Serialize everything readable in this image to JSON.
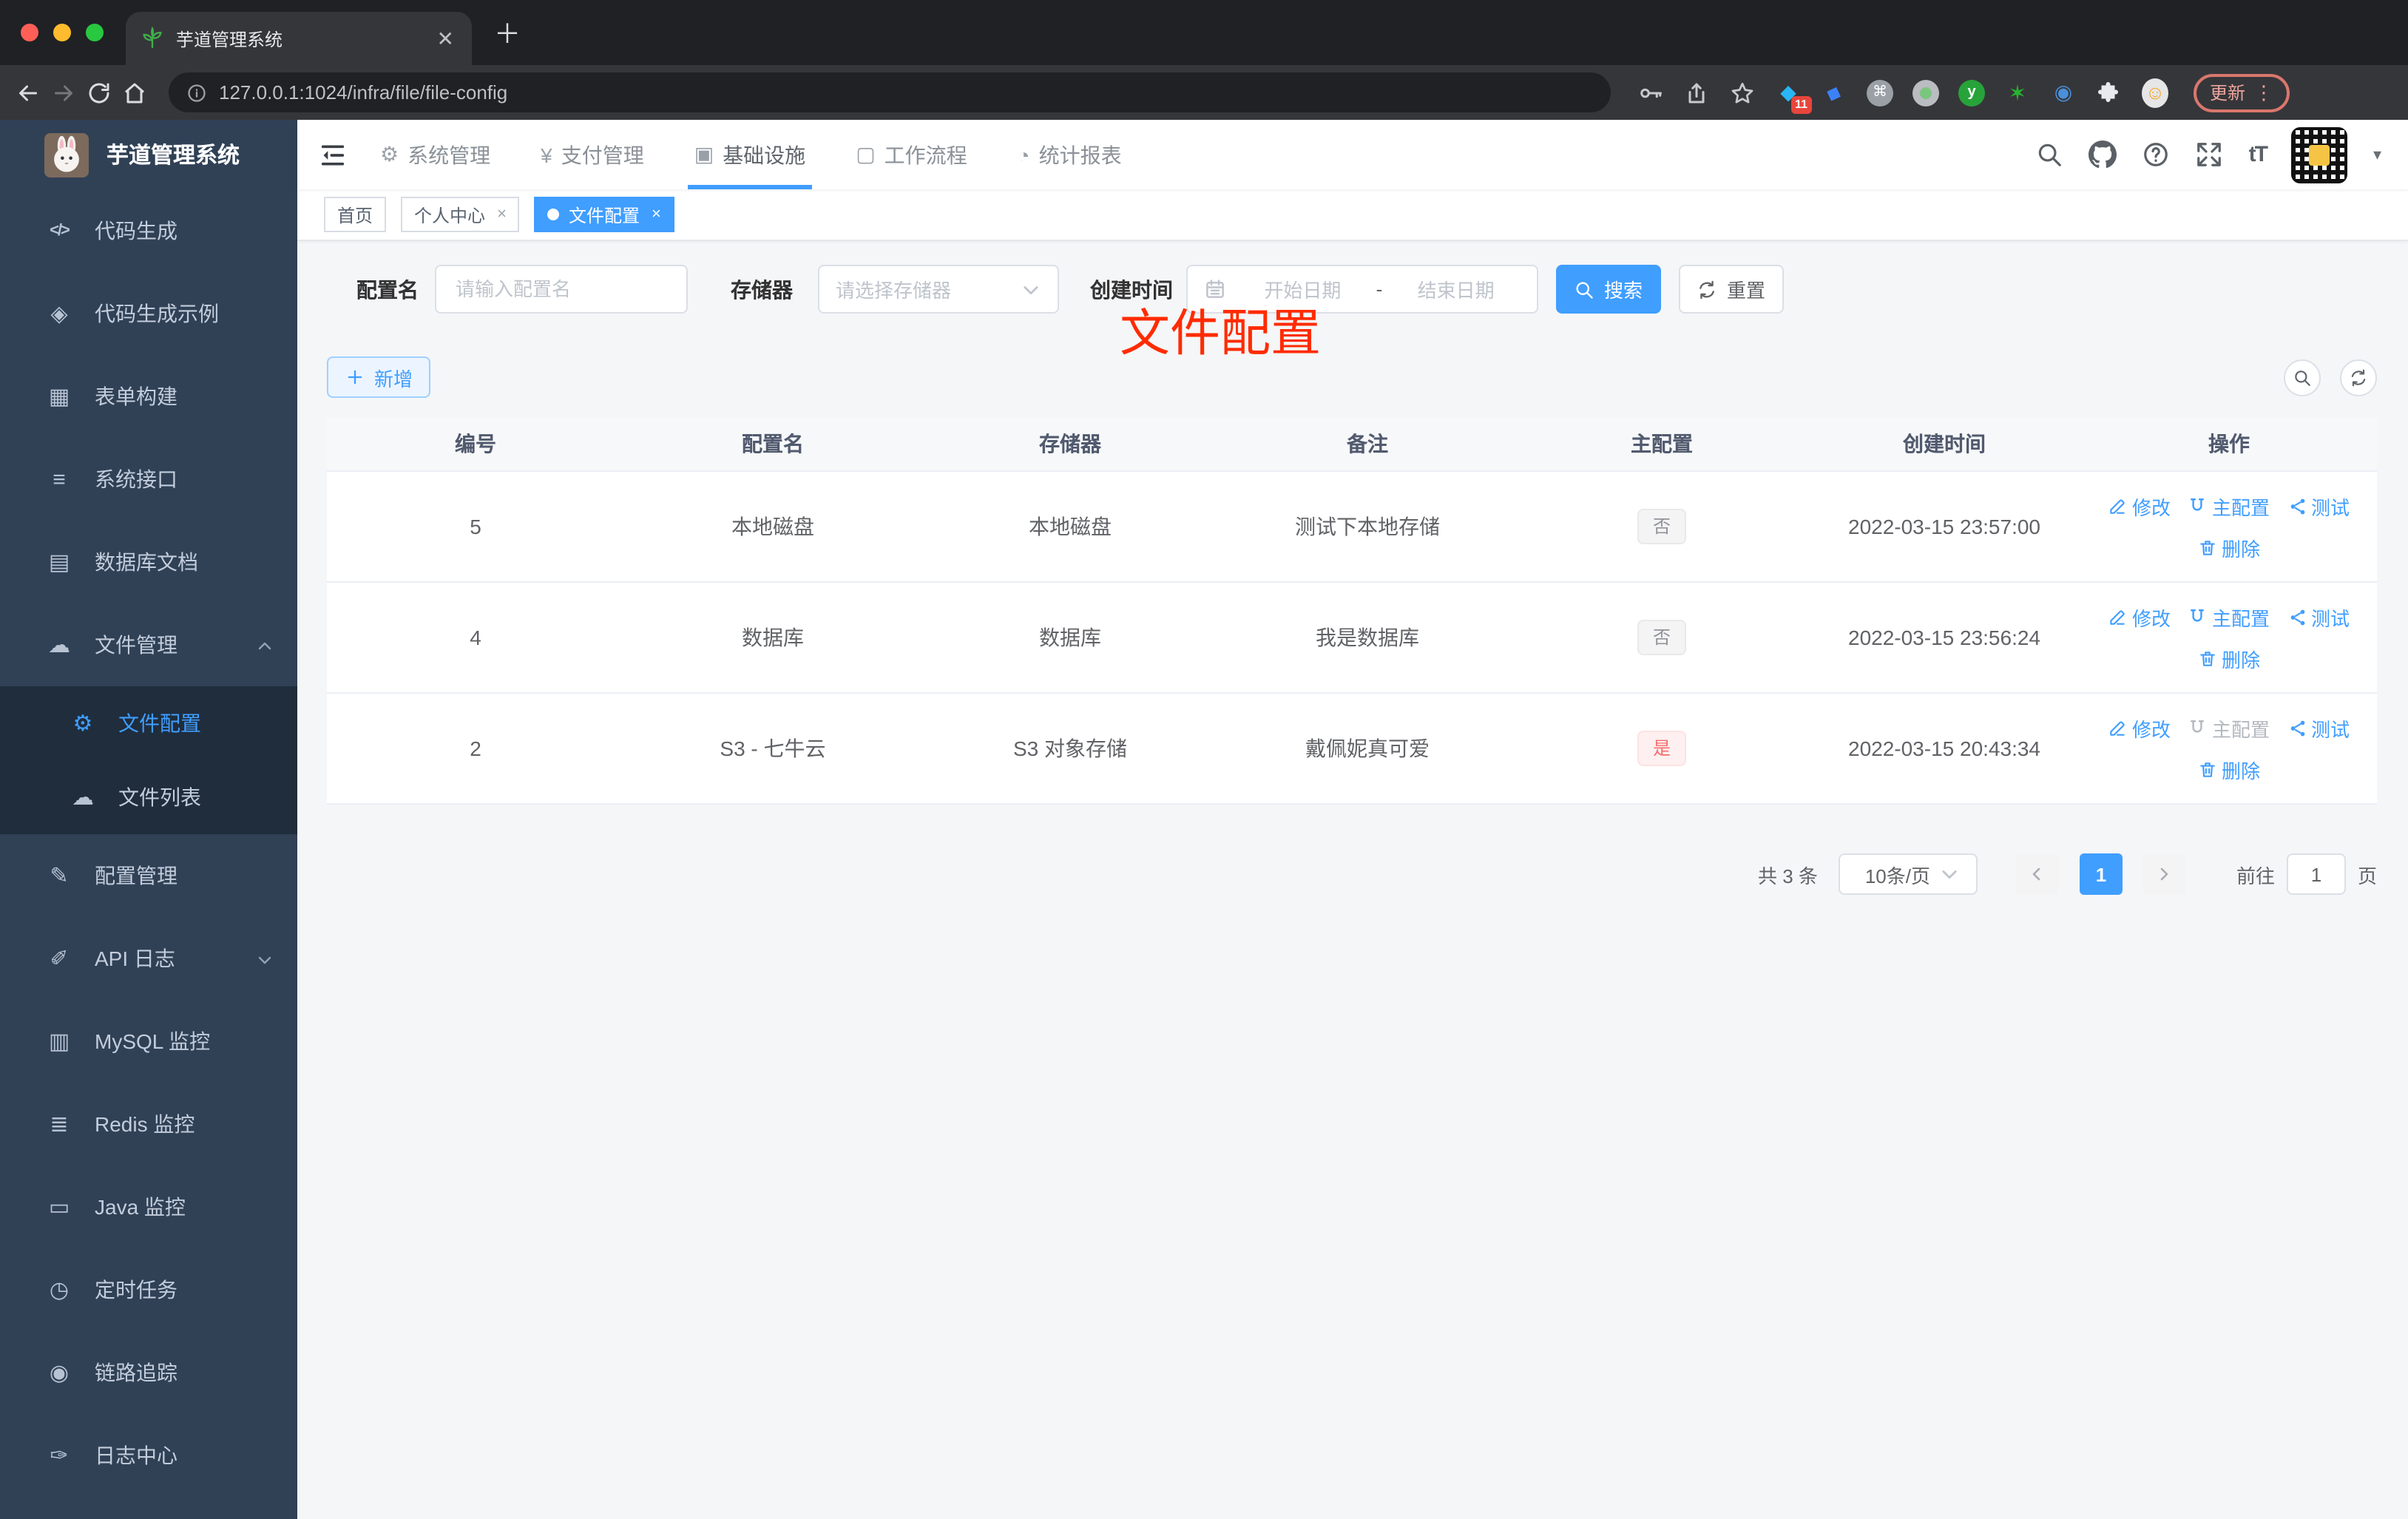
{
  "browser": {
    "tab_title": "芋道管理系统",
    "url": "127.0.0.1:1024/infra/file/file-config",
    "update_label": "更新",
    "ext_badge": "11",
    "cmd_glyph": "⌘",
    "y_glyph": "y"
  },
  "header": {
    "menus": [
      {
        "label": "系统管理",
        "icon": "⚙"
      },
      {
        "label": "支付管理",
        "icon": "¥"
      },
      {
        "label": "基础设施",
        "icon": "▣"
      },
      {
        "label": "工作流程",
        "icon": "▢"
      },
      {
        "label": "统计报表",
        "icon": "◔"
      }
    ],
    "font_size_glyph": "tT",
    "caret_glyph": "▾"
  },
  "sidebar": {
    "title": "芋道管理系统",
    "items": [
      {
        "label": "代码生成",
        "icon": "</>"
      },
      {
        "label": "代码生成示例",
        "icon": "◈"
      },
      {
        "label": "表单构建",
        "icon": "▦"
      },
      {
        "label": "系统接口",
        "icon": "≡"
      },
      {
        "label": "数据库文档",
        "icon": "▤"
      },
      {
        "label": "文件管理",
        "icon": "☁"
      },
      {
        "label": "文件配置",
        "icon": "⚙"
      },
      {
        "label": "文件列表",
        "icon": "☁"
      },
      {
        "label": "配置管理",
        "icon": "✎"
      },
      {
        "label": "API 日志",
        "icon": "✐"
      },
      {
        "label": "MySQL 监控",
        "icon": "▥"
      },
      {
        "label": "Redis 监控",
        "icon": "≣"
      },
      {
        "label": "Java 监控",
        "icon": "▭"
      },
      {
        "label": "定时任务",
        "icon": "◷"
      },
      {
        "label": "链路追踪",
        "icon": "◉"
      },
      {
        "label": "日志中心",
        "icon": "✑"
      }
    ]
  },
  "tags": {
    "items": [
      {
        "label": "首页"
      },
      {
        "label": "个人中心",
        "close": "×"
      },
      {
        "label": "文件配置",
        "close": "×"
      }
    ]
  },
  "annotation": "文件配置",
  "filters": {
    "name_label": "配置名",
    "name_placeholder": "请输入配置名",
    "storage_label": "存储器",
    "storage_placeholder": "请选择存储器",
    "created_label": "创建时间",
    "start_placeholder": "开始日期",
    "range_separator": "-",
    "end_placeholder": "结束日期",
    "search_label": "搜索",
    "reset_label": "重置"
  },
  "toolbar": {
    "add_label": "新增"
  },
  "table": {
    "columns": [
      "编号",
      "配置名",
      "存储器",
      "备注",
      "主配置",
      "创建时间",
      "操作"
    ],
    "actions": {
      "edit": "修改",
      "master": "主配置",
      "test": "测试",
      "del": "删除"
    },
    "rows": [
      {
        "id": "5",
        "name": "本地磁盘",
        "storage": "本地磁盘",
        "remark": "测试下本地存储",
        "master": "否",
        "created": "2022-03-15 23:57:00"
      },
      {
        "id": "4",
        "name": "数据库",
        "storage": "数据库",
        "remark": "我是数据库",
        "master": "否",
        "created": "2022-03-15 23:56:24"
      },
      {
        "id": "2",
        "name": "S3 - 七牛云",
        "storage": "S3 对象存储",
        "remark": "戴佩妮真可爱",
        "master": "是",
        "created": "2022-03-15 20:43:34"
      }
    ]
  },
  "pagination": {
    "total": "共 3 条",
    "page_size": "10条/页",
    "page": "1",
    "goto_prefix": "前往",
    "goto_value": "1",
    "goto_suffix": "页"
  },
  "colors": {
    "accent": "#409eff",
    "danger": "#f56c6c",
    "annotation": "#ff2b00",
    "sidebar": "#304156"
  }
}
